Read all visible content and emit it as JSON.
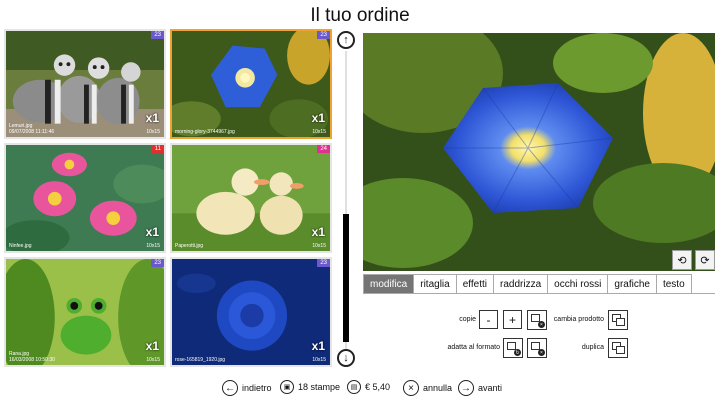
{
  "title": "Il tuo ordine",
  "thumbnails": [
    {
      "badge": "23",
      "badge_color": "#6a5acd",
      "qty": "x1",
      "size": "10x15",
      "filename": "Lemuri.jpg",
      "date": "09/07/2008 11:11:46",
      "selected": false
    },
    {
      "badge": "23",
      "badge_color": "#6a5acd",
      "qty": "x1",
      "size": "10x15",
      "filename": "morning-glory-3744967.jpg",
      "date": "",
      "selected": true
    },
    {
      "badge": "11",
      "badge_color": "#e03030",
      "qty": "x1",
      "size": "10x15",
      "filename": "Ninfee.jpg",
      "date": "",
      "selected": false
    },
    {
      "badge": "24",
      "badge_color": "#e03090",
      "qty": "x1",
      "size": "10x15",
      "filename": "Paperotti.jpg",
      "date": "",
      "selected": false
    },
    {
      "badge": "23",
      "badge_color": "#6a5acd",
      "qty": "x1",
      "size": "10x15",
      "filename": "Rana.jpg",
      "date": "16/03/2008 10:50:30",
      "selected": false
    },
    {
      "badge": "23",
      "badge_color": "#6a5acd",
      "qty": "x1",
      "size": "10x15",
      "filename": "rose-165819_1920.jpg",
      "date": "",
      "selected": false
    }
  ],
  "tabs": [
    "modifica",
    "ritaglia",
    "effetti",
    "raddrizza",
    "occhi rossi",
    "grafiche",
    "testo"
  ],
  "active_tab": "modifica",
  "controls": {
    "copie_label": "copie",
    "minus": "-",
    "plus": "+",
    "cambia_prodotto_label": "cambia prodotto",
    "adatta_label": "adatta al formato",
    "duplica_label": "duplica"
  },
  "footer": {
    "back": "indietro",
    "prints": "18 stampe",
    "price": "€ 5,40",
    "cancel": "annulla",
    "forward": "avanti"
  },
  "colors": {
    "accent": "#f0a22e",
    "tab_active": "#757575"
  }
}
